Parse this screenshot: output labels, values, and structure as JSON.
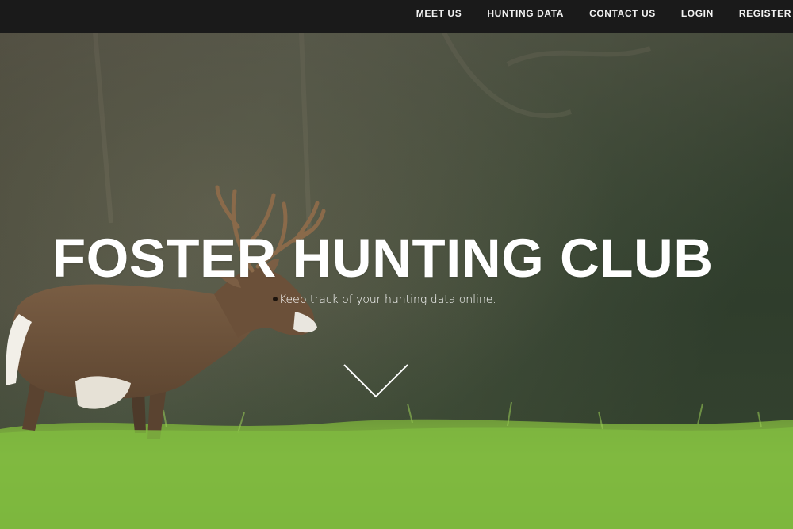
{
  "nav": {
    "items": [
      {
        "label": "MEET US"
      },
      {
        "label": "HUNTING DATA"
      },
      {
        "label": "CONTACT US"
      },
      {
        "label": "LOGIN"
      },
      {
        "label": "REGISTER"
      }
    ]
  },
  "hero": {
    "title": "FOSTER HUNTING CLUB",
    "subtitle": "Keep track of your hunting data online.",
    "scroll_icon": "chevron-down-icon",
    "background_subject": "deer-in-grass-photo"
  },
  "colors": {
    "navbar": "#1a1a1a",
    "nav_text": "#f2f2f2",
    "title_text": "#ffffff",
    "grass": "#7dbb3c",
    "forest": "#3d4a36"
  }
}
